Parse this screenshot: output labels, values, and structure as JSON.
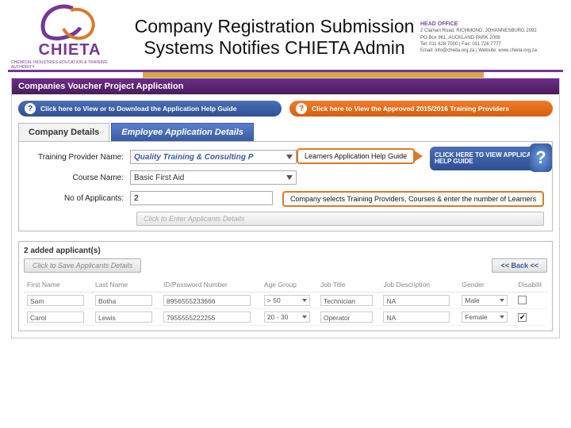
{
  "header": {
    "logo_word": "CHIETA",
    "logo_tag": "CHEMICAL INDUSTRIES EDUCATION & TRAINING AUTHORITY",
    "title_line1": "Company Registration Submission",
    "title_line2": "Systems Notifies CHIETA Admin",
    "contact_head": "HEAD OFFICE",
    "contact_line1": "2 Clamart Road, RICHMOND, JOHANNESBURG 2092",
    "contact_line2": "PO Box 961, AUCKLAND PARK 2006",
    "contact_line3": "Tel: 011 628 7000 | Fax: 011 726 7777",
    "contact_line4": "Email: info@chieta.org.za | Website: www.chieta.org.za"
  },
  "panel": {
    "title": "Companies Voucher Project Application",
    "guide_left": "Click here to View or to Download the Application Help Guide",
    "guide_right": "Click here to View the Approved 2015/2016 Training Providers",
    "tabs": {
      "company": "Company Details",
      "employee": "Employee Application Details"
    },
    "form": {
      "provider_label": "Training Provider Name:",
      "provider_value": "Quality Training & Consulting P",
      "course_label": "Course Name:",
      "course_value": "Basic First Aid",
      "applicants_label": "No of Applicants:",
      "applicants_value": "2",
      "enter_btn": "Click to Enter Applicants Details"
    },
    "help_pill": "CLICK HERE TO VIEW APPLICANTS HELP GUIDE",
    "callout1": "Learners Application Help Guide",
    "callout2": "Company selects Training Providers, Courses  & enter the number of Learners"
  },
  "added": {
    "count_label": "2 added applicant(s)",
    "save_btn": "Click to Save Applicants Details",
    "back_btn": "<< Back <<",
    "columns": [
      "First Name",
      "Last Name",
      "ID/Password Number",
      "Age Group",
      "Job Title",
      "Job Description",
      "Gender",
      "Disabilit"
    ],
    "rows": [
      {
        "first": "Sam",
        "last": "Botha",
        "id": "8956555233666",
        "age": "> 50",
        "title": "Technician",
        "desc": "NA",
        "gender": "Male",
        "disabled": false
      },
      {
        "first": "Carol",
        "last": "Lewis",
        "id": "7955555222255",
        "age": "20 - 30",
        "title": "Operator",
        "desc": "NA",
        "gender": "Female",
        "disabled": true
      }
    ]
  }
}
